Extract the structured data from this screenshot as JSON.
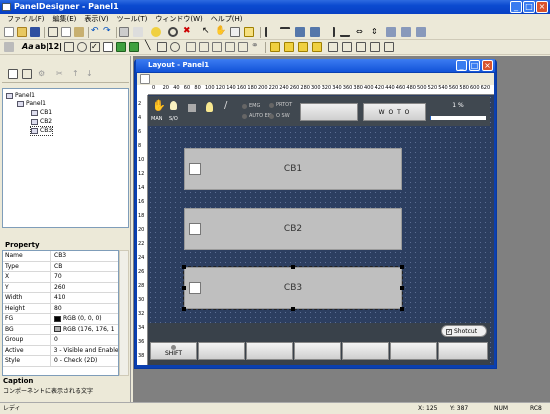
{
  "app": {
    "title": "PanelDesigner - Panel1"
  },
  "menu": [
    "ファイル(F)",
    "編集(E)",
    "表示(V)",
    "ツール(T)",
    "ウィンドウ(W)",
    "ヘルプ(H)"
  ],
  "toolbar2": {
    "aa_label": "Aa",
    "abl_label": "ab|",
    "num_label": "12|"
  },
  "tree": {
    "root": "Panel1",
    "child": "Panel1",
    "items": [
      "CB1",
      "CB2",
      "CB3"
    ]
  },
  "properties": {
    "header": "Property",
    "rows": [
      {
        "key": "Name",
        "value": "CB3"
      },
      {
        "key": "Type",
        "value": "CB"
      },
      {
        "key": "X",
        "value": "70"
      },
      {
        "key": "Y",
        "value": "260"
      },
      {
        "key": "Width",
        "value": "410"
      },
      {
        "key": "Height",
        "value": "80"
      },
      {
        "key": "FG",
        "value": "RGB (0, 0, 0)",
        "swatch": "#000000"
      },
      {
        "key": "BG",
        "value": "RGB (176, 176, 1",
        "swatch": "#b0b0b0"
      },
      {
        "key": "Group",
        "value": "0"
      },
      {
        "key": "Active",
        "value": "3 - Visible and Enable"
      },
      {
        "key": "Style",
        "value": "0 - Check (2D)"
      }
    ],
    "caption_title": "Caption",
    "caption_text": "コンポーネントに表示される文字"
  },
  "layout": {
    "title": "Layout - Panel1",
    "ruler_ticks": [
      "0",
      "20",
      "40",
      "60",
      "80",
      "100",
      "120",
      "140",
      "160",
      "180",
      "200",
      "220",
      "240",
      "260",
      "280",
      "300",
      "320",
      "340",
      "360",
      "380",
      "400",
      "420",
      "440",
      "460",
      "480",
      "500",
      "520",
      "540",
      "560",
      "580",
      "600",
      "620",
      "640"
    ],
    "ruler_v_ticks": [
      "2",
      "4",
      "6",
      "8",
      "10",
      "12",
      "14",
      "16",
      "18",
      "20",
      "22",
      "24",
      "26",
      "28",
      "30",
      "32",
      "34",
      "36",
      "38"
    ],
    "top": {
      "man": "MAN",
      "sio": "S/O",
      "emg": "EMG",
      "autoen": "AUTO EN",
      "prtot": "PRTOT",
      "osw": "O SW",
      "woto": "W O T O",
      "percent": "1 %",
      "progress": 0.01
    },
    "checkboxes": [
      "CB1",
      "CB2",
      "CB3"
    ],
    "shortcut_label": "Shotcut",
    "shift_label": "SHIFT"
  },
  "status": {
    "left": "レディ",
    "x_label": "X: 125",
    "y_label": "Y: 387",
    "num": "NUM",
    "rc": "RC8"
  },
  "colors": {
    "titlebar": "#0a4ad0",
    "canvas": "#2c3e60",
    "checkbox_bg": "#bfbfbf"
  }
}
